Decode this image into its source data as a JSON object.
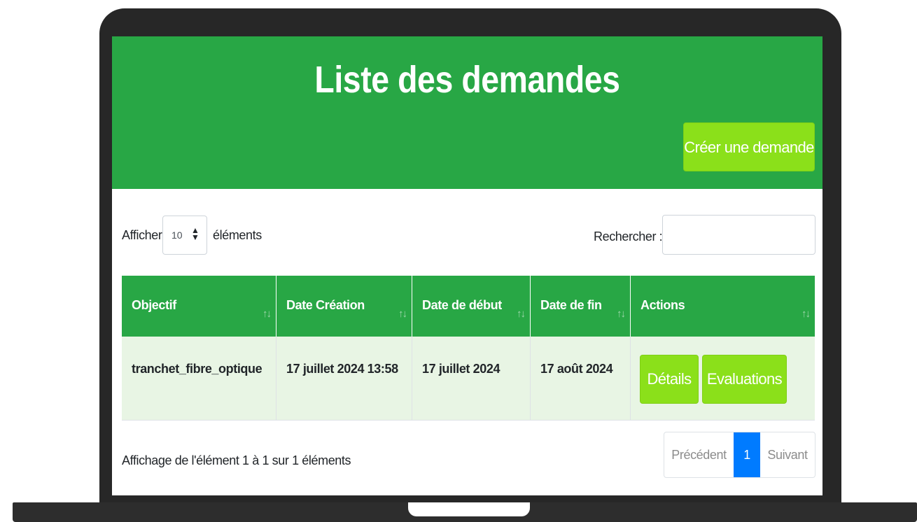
{
  "header": {
    "title": "Liste des demandes",
    "create_button": "Créer une demande"
  },
  "controls": {
    "show_prefix": "Afficher",
    "length_value": "10",
    "show_suffix": "éléments",
    "search_label": "Rechercher :",
    "search_value": ""
  },
  "table": {
    "columns": [
      "Objectif",
      "Date Création",
      "Date de début",
      "Date de fin",
      "Actions"
    ],
    "rows": [
      {
        "objectif": "tranchet_fibre_optique",
        "date_creation": "17 juillet 2024 13:58",
        "date_debut": "17 juillet 2024",
        "date_fin": "17 août 2024",
        "actions": [
          "Détails",
          "Evaluations"
        ]
      }
    ]
  },
  "footer": {
    "info": "Affichage de l'élément 1 à 1 sur 1 éléments",
    "prev": "Précédent",
    "current_page": "1",
    "next": "Suivant"
  },
  "colors": {
    "header_bg": "#28a745",
    "button_bg": "#8be01a",
    "row_bg": "#e8f5e4",
    "active_page": "#007bff"
  }
}
